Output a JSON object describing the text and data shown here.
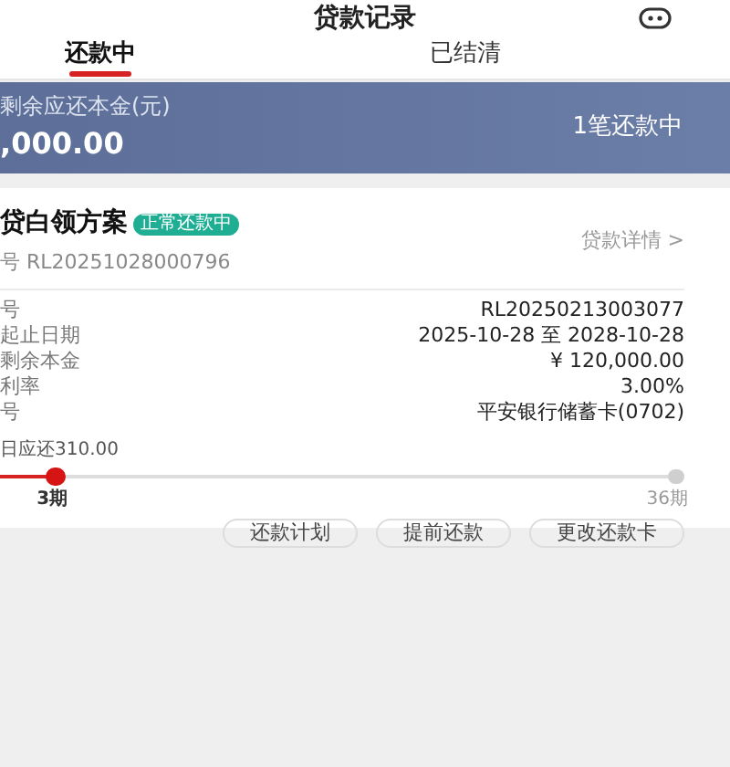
{
  "header": {
    "title": "贷款记录"
  },
  "tabs": [
    {
      "label": "还款中",
      "selected": true
    },
    {
      "label": "已结清",
      "selected": false
    }
  ],
  "summary": {
    "label": "剩余应还本金(元)",
    "amount": ",000.00",
    "count": "1笔还款中"
  },
  "loan": {
    "name": "贷白领方案",
    "status": "正常还款中",
    "number": "号 RL20251028000796",
    "detail_link": "贷款详情 >",
    "rows": [
      {
        "label": "号",
        "value": "RL20250213003077"
      },
      {
        "label": "起止日期",
        "value": "2025-10-28 至 2028-10-28"
      },
      {
        "label": "剩余本金",
        "value": "¥ 120,000.00"
      },
      {
        "label": "利率",
        "value": "3.00%"
      },
      {
        "label": "号",
        "value": "平安银行储蓄卡(0702)"
      }
    ],
    "due": "日应还310.00",
    "progress": {
      "level": 0.083,
      "current": "3期",
      "total": "36期"
    },
    "buttons": [
      "还款计划",
      "提前还款",
      "更改还款卡"
    ]
  }
}
